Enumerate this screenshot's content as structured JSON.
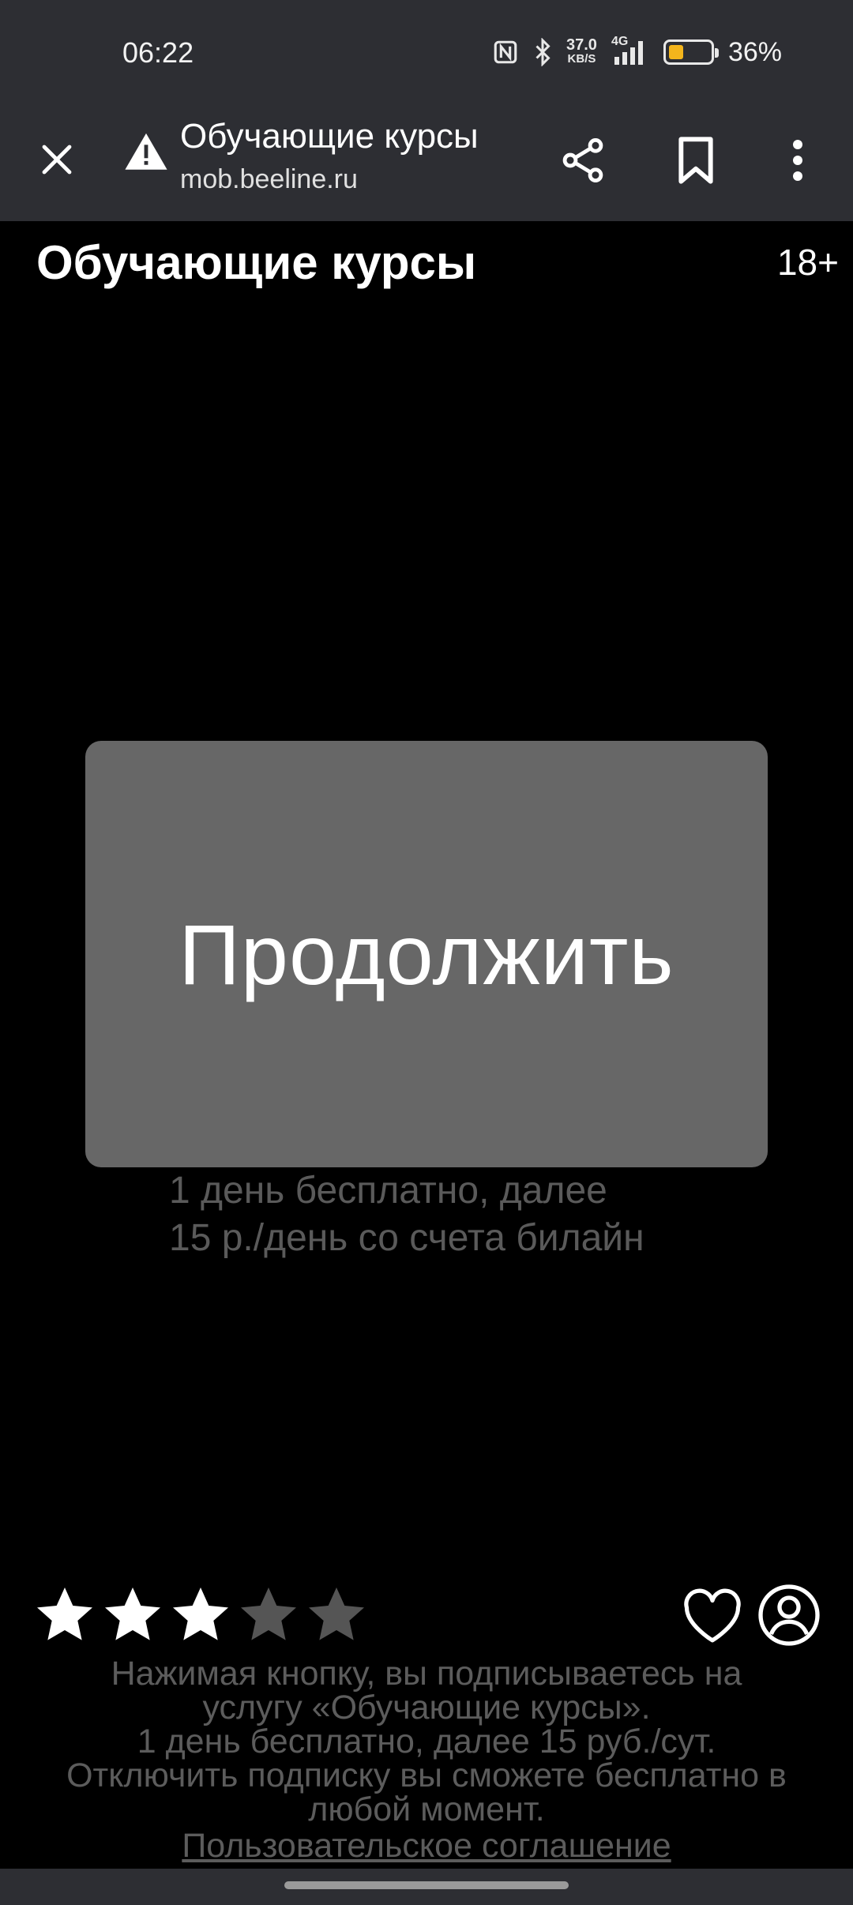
{
  "status_bar": {
    "time": "06:22",
    "speed_value": "37.0",
    "speed_unit": "KB/S",
    "network": "4G",
    "battery_percent": "36%",
    "battery_level": 0.36,
    "battery_color": "#f3b51c",
    "icons": [
      "nfc-icon",
      "bluetooth-icon",
      "signal-icon",
      "battery-icon"
    ]
  },
  "browser": {
    "title": "Обучающие курсы",
    "url": "mob.beeline.ru",
    "icons": [
      "close-icon",
      "warning-icon",
      "share-icon",
      "bookmark-icon",
      "more-vert-icon"
    ]
  },
  "content": {
    "title": "Обучающие курсы",
    "age_rating": "18+",
    "continue_label": "Продолжить",
    "price_line1": "1 день бесплатно, далее",
    "price_line2": "15 р./день со счета билайн",
    "button_color": "#676767"
  },
  "rating": {
    "stars_filled": 3,
    "stars_total": 5
  },
  "footer": {
    "disclaimer_line1": "Нажимая кнопку, вы подписываетесь на",
    "disclaimer_line2": "услугу «Обучающие курсы».",
    "disclaimer_line3": "1 день бесплатно, далее 15 руб./сут.",
    "disclaimer_line4": "Отключить подписку вы сможете бесплатно в",
    "disclaimer_line5": "любой момент.",
    "agreement_link": "Пользовательское соглашение"
  }
}
